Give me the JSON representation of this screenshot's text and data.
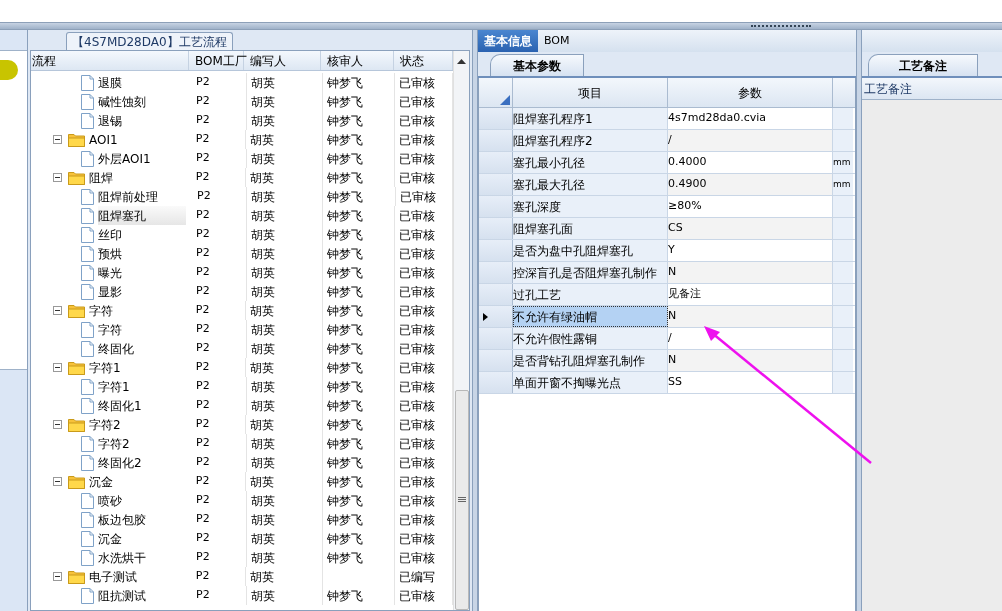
{
  "process_panel": {
    "title": "【4S7MD28DA0】工艺流程",
    "columns": [
      "流程",
      "BOM工厂",
      "编写人",
      "核审人",
      "状态"
    ],
    "tree": [
      {
        "children": [
          {
            "kind": "file",
            "label": "退膜",
            "factory": "P2",
            "writer": "胡英",
            "reviewer": "钟梦飞",
            "status": "已审核",
            "selected": false
          },
          {
            "kind": "file",
            "label": "碱性蚀刻",
            "factory": "P2",
            "writer": "胡英",
            "reviewer": "钟梦飞",
            "status": "已审核",
            "selected": false
          },
          {
            "kind": "file",
            "label": "退锡",
            "factory": "P2",
            "writer": "胡英",
            "reviewer": "钟梦飞",
            "status": "已审核",
            "selected": false
          }
        ]
      },
      {
        "kind": "folder",
        "label": "AOI1",
        "factory": "P2",
        "writer": "胡英",
        "reviewer": "钟梦飞",
        "status": "已审核",
        "selected": false,
        "expanded": true,
        "children": [
          {
            "kind": "file",
            "label": "外层AOI1",
            "factory": "P2",
            "writer": "胡英",
            "reviewer": "钟梦飞",
            "status": "已审核",
            "selected": false
          }
        ]
      },
      {
        "kind": "folder",
        "label": "阻焊",
        "factory": "P2",
        "writer": "胡英",
        "reviewer": "钟梦飞",
        "status": "已审核",
        "selected": false,
        "expanded": true,
        "children": [
          {
            "kind": "file",
            "label": "阻焊前处理",
            "factory": "P2",
            "writer": "胡英",
            "reviewer": "钟梦飞",
            "status": "已审核",
            "selected": false
          },
          {
            "kind": "file",
            "label": "阻焊塞孔",
            "factory": "P2",
            "writer": "胡英",
            "reviewer": "钟梦飞",
            "status": "已审核",
            "selected": true
          },
          {
            "kind": "file",
            "label": "丝印",
            "factory": "P2",
            "writer": "胡英",
            "reviewer": "钟梦飞",
            "status": "已审核",
            "selected": false
          },
          {
            "kind": "file",
            "label": "预烘",
            "factory": "P2",
            "writer": "胡英",
            "reviewer": "钟梦飞",
            "status": "已审核",
            "selected": false
          },
          {
            "kind": "file",
            "label": "曝光",
            "factory": "P2",
            "writer": "胡英",
            "reviewer": "钟梦飞",
            "status": "已审核",
            "selected": false
          },
          {
            "kind": "file",
            "label": "显影",
            "factory": "P2",
            "writer": "胡英",
            "reviewer": "钟梦飞",
            "status": "已审核",
            "selected": false
          }
        ]
      },
      {
        "kind": "folder",
        "label": "字符",
        "factory": "P2",
        "writer": "胡英",
        "reviewer": "钟梦飞",
        "status": "已审核",
        "selected": false,
        "expanded": true,
        "children": [
          {
            "kind": "file",
            "label": "字符",
            "factory": "P2",
            "writer": "胡英",
            "reviewer": "钟梦飞",
            "status": "已审核",
            "selected": false
          },
          {
            "kind": "file",
            "label": "终固化",
            "factory": "P2",
            "writer": "胡英",
            "reviewer": "钟梦飞",
            "status": "已审核",
            "selected": false
          }
        ]
      },
      {
        "kind": "folder",
        "label": "字符1",
        "factory": "P2",
        "writer": "胡英",
        "reviewer": "钟梦飞",
        "status": "已审核",
        "selected": false,
        "expanded": true,
        "children": [
          {
            "kind": "file",
            "label": "字符1",
            "factory": "P2",
            "writer": "胡英",
            "reviewer": "钟梦飞",
            "status": "已审核",
            "selected": false
          },
          {
            "kind": "file",
            "label": "终固化1",
            "factory": "P2",
            "writer": "胡英",
            "reviewer": "钟梦飞",
            "status": "已审核",
            "selected": false
          }
        ]
      },
      {
        "kind": "folder",
        "label": "字符2",
        "factory": "P2",
        "writer": "胡英",
        "reviewer": "钟梦飞",
        "status": "已审核",
        "selected": false,
        "expanded": true,
        "children": [
          {
            "kind": "file",
            "label": "字符2",
            "factory": "P2",
            "writer": "胡英",
            "reviewer": "钟梦飞",
            "status": "已审核",
            "selected": false
          },
          {
            "kind": "file",
            "label": "终固化2",
            "factory": "P2",
            "writer": "胡英",
            "reviewer": "钟梦飞",
            "status": "已审核",
            "selected": false
          }
        ]
      },
      {
        "kind": "folder",
        "label": "沉金",
        "factory": "P2",
        "writer": "胡英",
        "reviewer": "钟梦飞",
        "status": "已审核",
        "selected": false,
        "expanded": true,
        "children": [
          {
            "kind": "file",
            "label": "喷砂",
            "factory": "P2",
            "writer": "胡英",
            "reviewer": "钟梦飞",
            "status": "已审核",
            "selected": false
          },
          {
            "kind": "file",
            "label": "板边包胶",
            "factory": "P2",
            "writer": "胡英",
            "reviewer": "钟梦飞",
            "status": "已审核",
            "selected": false
          },
          {
            "kind": "file",
            "label": "沉金",
            "factory": "P2",
            "writer": "胡英",
            "reviewer": "钟梦飞",
            "status": "已审核",
            "selected": false
          },
          {
            "kind": "file",
            "label": "水洗烘干",
            "factory": "P2",
            "writer": "胡英",
            "reviewer": "钟梦飞",
            "status": "已审核",
            "selected": false
          }
        ]
      },
      {
        "kind": "folder",
        "label": "电子测试",
        "factory": "P2",
        "writer": "胡英",
        "status": "已编写",
        "selected": false,
        "expanded": true,
        "children": [
          {
            "kind": "file",
            "label": "阻抗测试",
            "factory": "P2",
            "writer": "胡英",
            "reviewer": "钟梦飞",
            "status": "已审核",
            "selected": false
          }
        ]
      }
    ]
  },
  "info_panel": {
    "tabs": [
      {
        "label": "基本信息",
        "selected": true
      },
      {
        "label": "BOM",
        "selected": false
      }
    ],
    "params_tab": "基本参数",
    "columns": [
      "项目",
      "参数"
    ],
    "rows": [
      {
        "item": "阻焊塞孔程序1",
        "value": "4s7md28da0.cvia",
        "selected": false
      },
      {
        "item": "阻焊塞孔程序2",
        "value": "/",
        "selected": false
      },
      {
        "item": "塞孔最小孔径",
        "value": "0.4000",
        "unit": "mm",
        "selected": false
      },
      {
        "item": "塞孔最大孔径",
        "value": "0.4900",
        "unit": "mm",
        "selected": false
      },
      {
        "item": "塞孔深度",
        "value": "≥80%",
        "selected": false
      },
      {
        "item": "阻焊塞孔面",
        "value": "CS",
        "selected": false
      },
      {
        "item": "是否为盘中孔阻焊塞孔",
        "value": "Y",
        "selected": false
      },
      {
        "item": "控深盲孔是否阻焊塞孔制作",
        "value": "N",
        "selected": false
      },
      {
        "item": "过孔工艺",
        "value": "见备注",
        "selected": false
      },
      {
        "item": "不允许有绿油帽",
        "value": "N",
        "selected": true
      },
      {
        "item": "不允许假性露铜",
        "value": "/",
        "selected": false
      },
      {
        "item": "是否背钻孔阻焊塞孔制作",
        "value": "N",
        "selected": false
      },
      {
        "item": "单面开窗不掏曝光点",
        "value": "SS",
        "selected": false
      }
    ]
  },
  "notes_panel": {
    "tab": "工艺备注",
    "header": "工艺备注"
  }
}
